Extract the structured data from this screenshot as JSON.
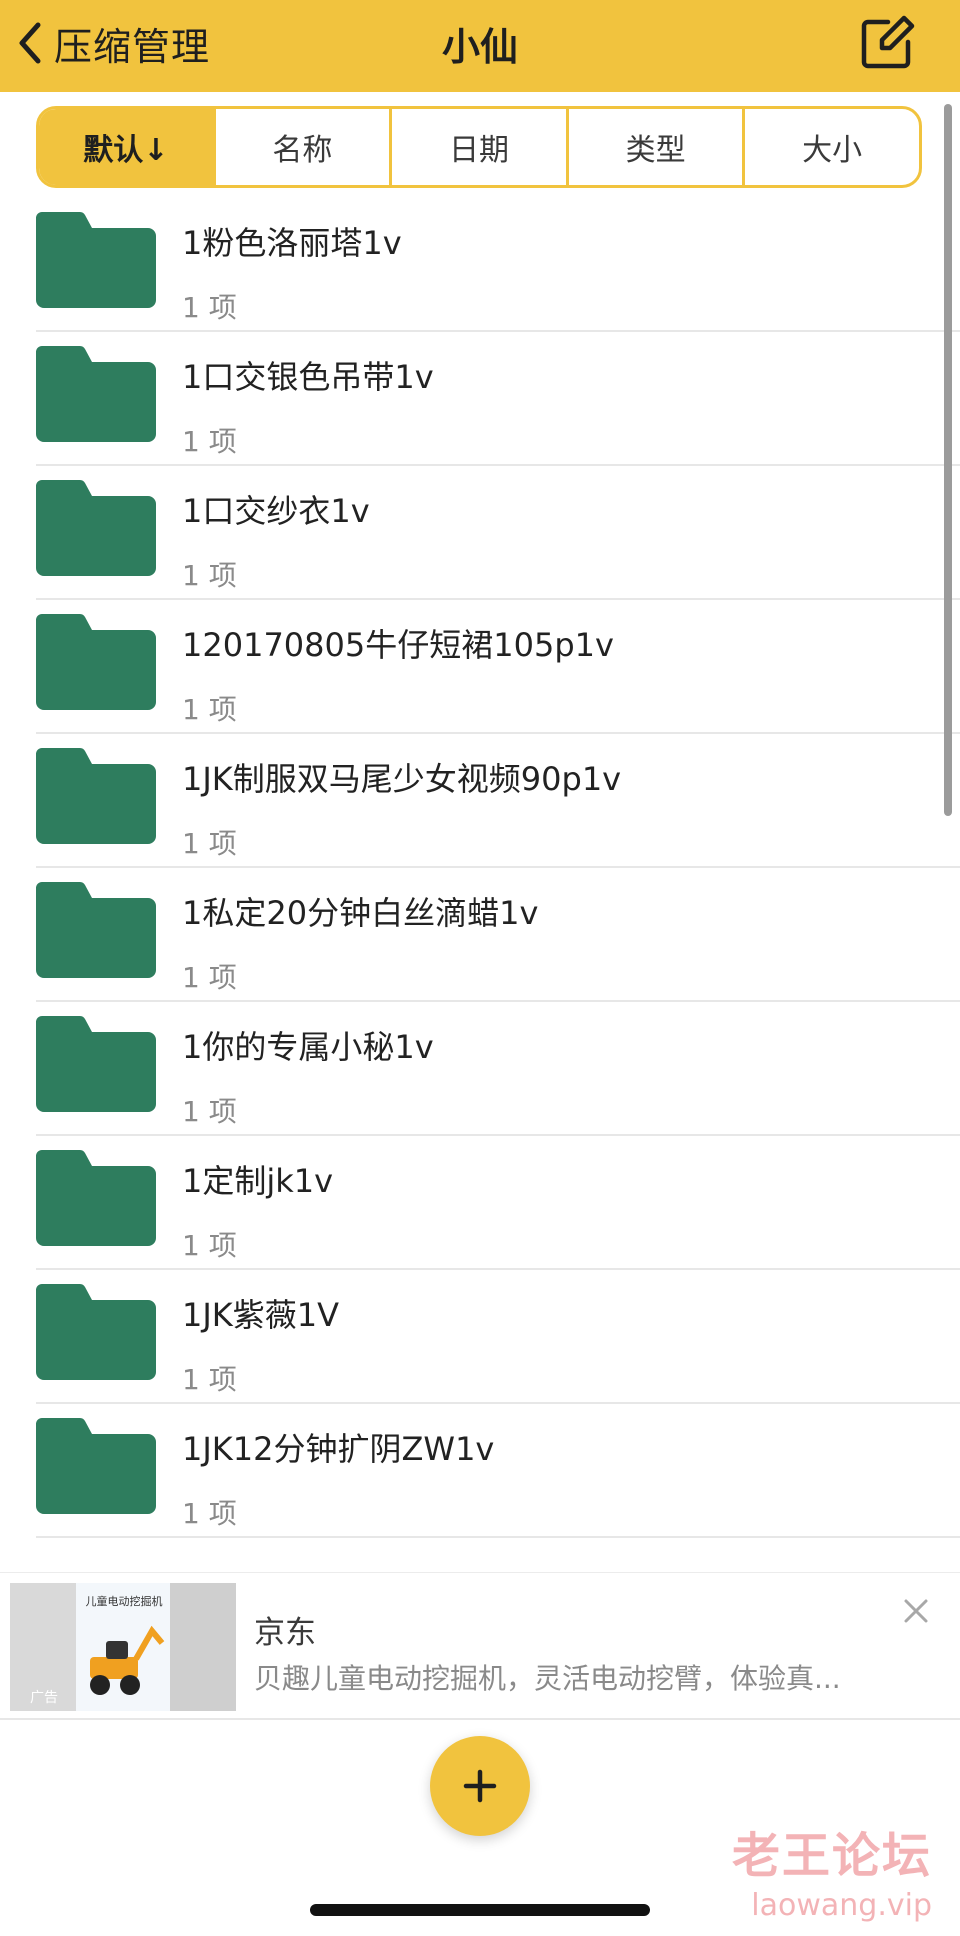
{
  "header": {
    "back_label": "压缩管理",
    "title": "小仙",
    "accent_color": "#f1c33e",
    "back_icon": "chevron-left-icon",
    "edit_icon": "compose-icon"
  },
  "sort_tabs": [
    {
      "label": "默认↓",
      "active": true
    },
    {
      "label": "名称",
      "active": false
    },
    {
      "label": "日期",
      "active": false
    },
    {
      "label": "类型",
      "active": false
    },
    {
      "label": "大小",
      "active": false
    }
  ],
  "folders": [
    {
      "name": "1粉色洛丽塔1v",
      "count": "1 项"
    },
    {
      "name": "1口交银色吊带1v",
      "count": "1 项"
    },
    {
      "name": "1口交纱衣1v",
      "count": "1 项"
    },
    {
      "name": "120170805牛仔短裙105p1v",
      "count": "1 项"
    },
    {
      "name": "1JK制服双马尾少女视频90p1v",
      "count": "1 项"
    },
    {
      "name": "1私定20分钟白丝滴蜡1v",
      "count": "1 项"
    },
    {
      "name": "1你的专属小秘1v",
      "count": "1 项"
    },
    {
      "name": "1定制jk1v",
      "count": "1 项"
    },
    {
      "name": "1JK紫薇1V",
      "count": "1 项"
    },
    {
      "name": "1JK12分钟扩阴ZW1v",
      "count": "1 项"
    }
  ],
  "folder_color": "#2e7d5e",
  "ad": {
    "source": "京东",
    "description": "贝趣儿童电动挖掘机，灵活电动挖臂，体验真...",
    "tag": "广告",
    "thumb_text": "儿童电动挖掘机",
    "close_icon": "close-icon"
  },
  "fab": {
    "icon": "plus-icon"
  },
  "watermark": {
    "cn": "老王论坛",
    "en": "laowang.vip"
  }
}
